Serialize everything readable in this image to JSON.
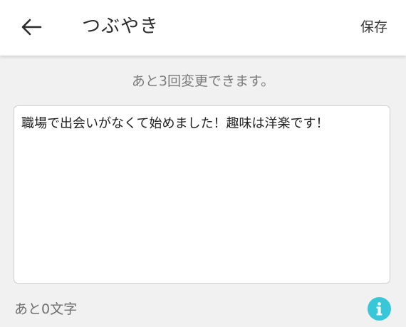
{
  "header": {
    "back_icon": "arrow-left-icon",
    "title": "つぶやき",
    "save_label": "保存"
  },
  "notice": "あと3回変更できます。",
  "editor": {
    "value": "職場で出会いがなくて始めました！趣味は洋楽です！"
  },
  "footer": {
    "counter": "あと0文字",
    "info_icon": "info-icon",
    "info_color": "#38c7d9"
  }
}
